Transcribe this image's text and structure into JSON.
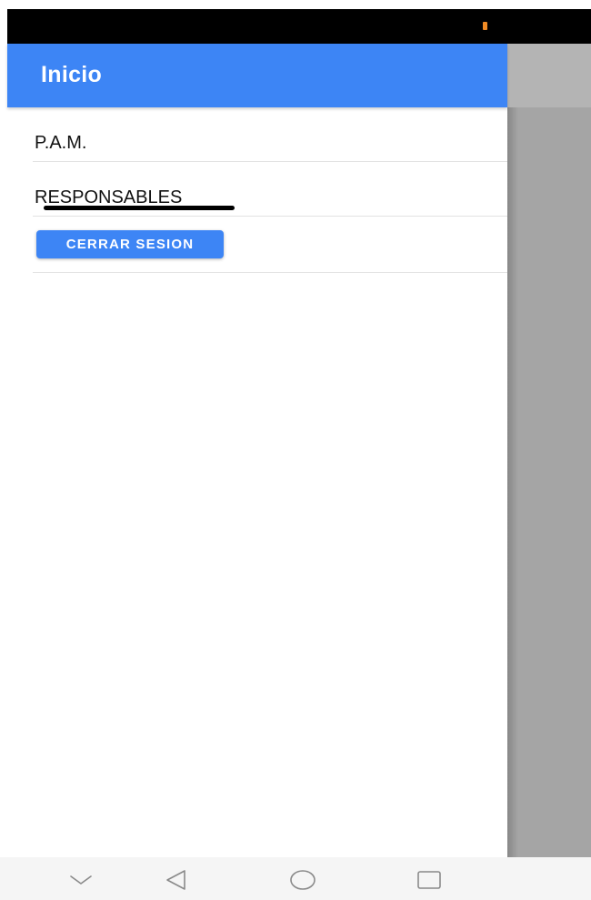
{
  "status_bar": {
    "battery_color": "#f08a24"
  },
  "drawer": {
    "title": "Inicio",
    "header_color": "#3d85f5",
    "items": [
      {
        "label": "P.A.M."
      },
      {
        "label": "RESPONSABLES"
      }
    ],
    "logout_label": "CERRAR SESION"
  },
  "nav_bar": {
    "buttons": [
      {
        "icon": "chevron-down-icon"
      },
      {
        "icon": "back-triangle-icon"
      },
      {
        "icon": "home-circle-icon"
      },
      {
        "icon": "recents-square-icon"
      }
    ]
  }
}
